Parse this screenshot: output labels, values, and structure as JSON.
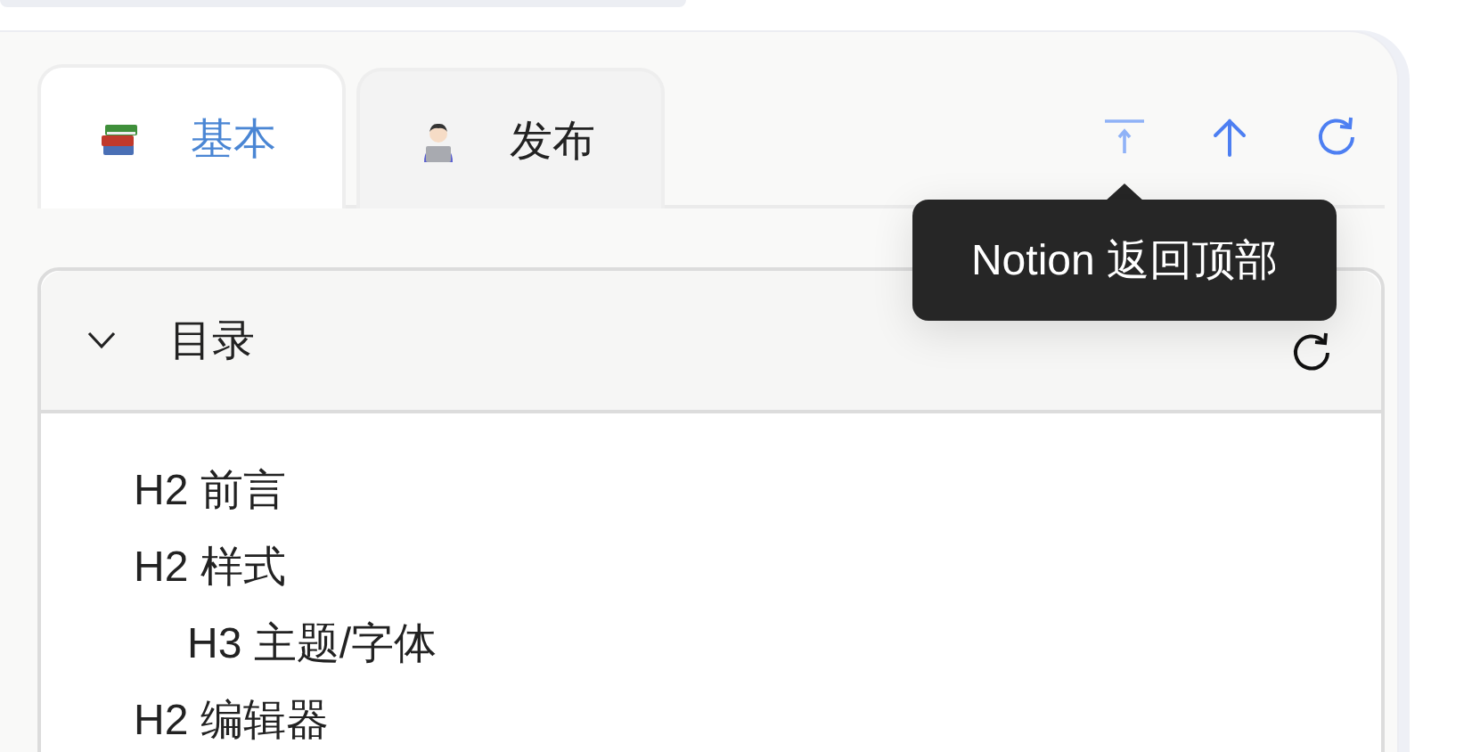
{
  "tabs": [
    {
      "label": "基本",
      "selected": true
    },
    {
      "label": "发布",
      "selected": false
    }
  ],
  "toolbar": {
    "tooltip": "Notion 返回顶部"
  },
  "outline": {
    "title": "目录",
    "expanded": true,
    "items": [
      {
        "label": "H2 前言"
      },
      {
        "label": "H2 样式",
        "children": [
          {
            "label": "H3 主题/字体"
          }
        ]
      },
      {
        "label": "H2 编辑器"
      }
    ]
  }
}
